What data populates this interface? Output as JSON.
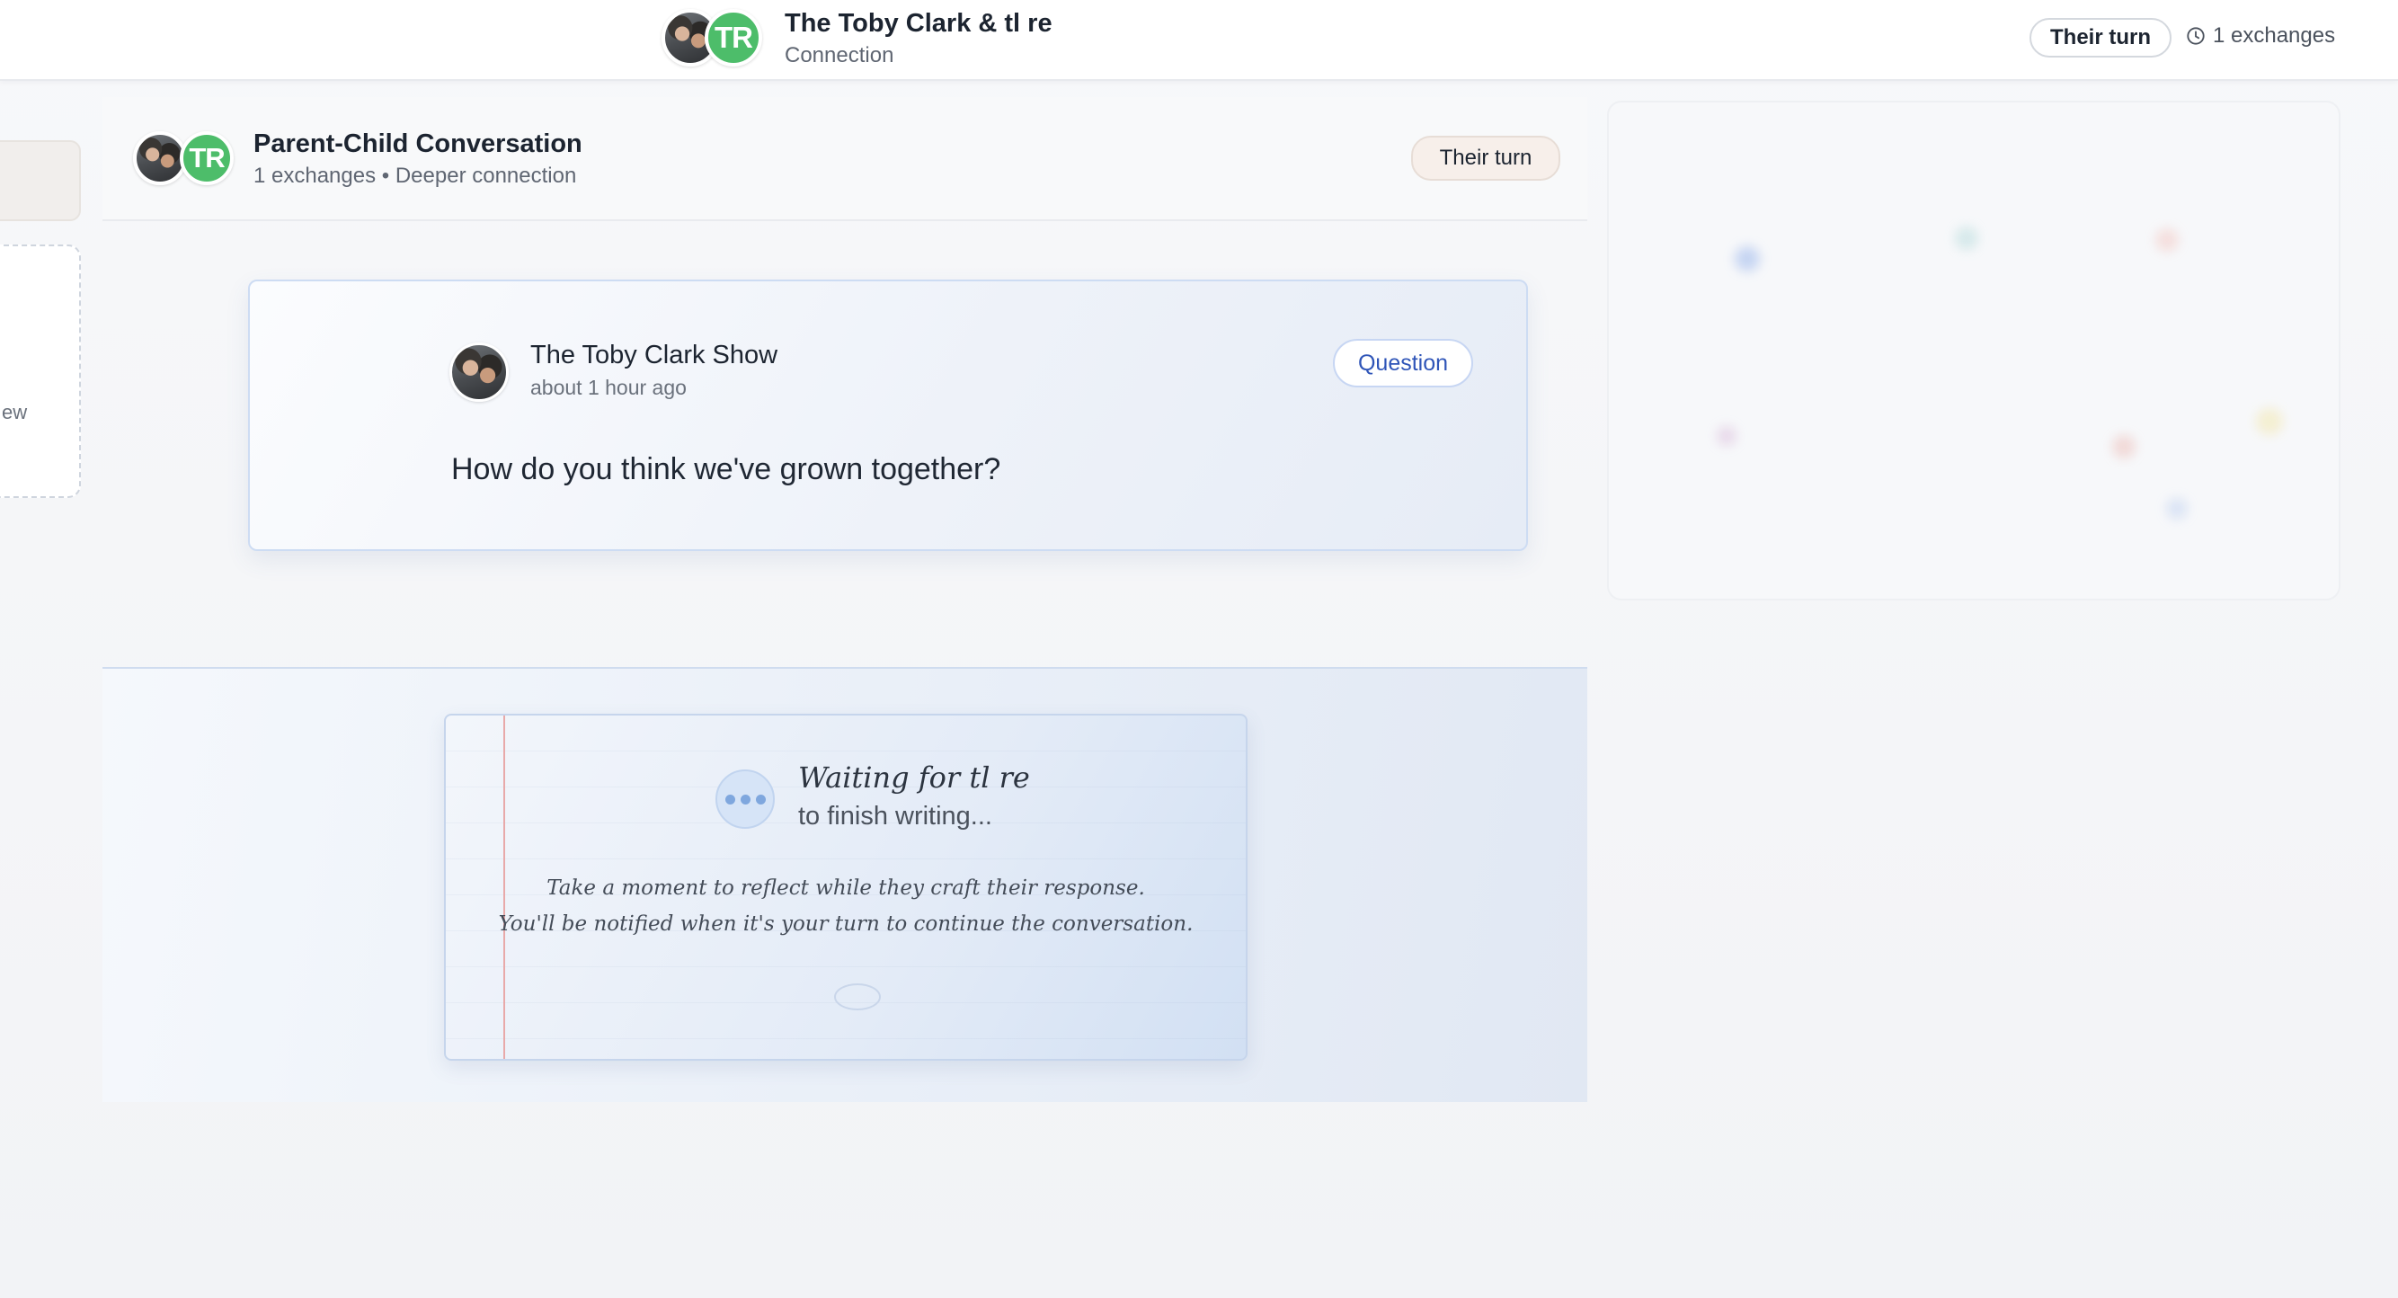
{
  "header": {
    "title": "The Toby Clark & tl re",
    "subtitle": "Connection",
    "avatar_initials": "TR",
    "turn_status": "Their turn",
    "exchanges": "1 exchanges",
    "clock_icon": "clock-icon"
  },
  "sidebar": {
    "partial_text": "ew"
  },
  "conversation": {
    "title": "Parent-Child Conversation",
    "meta": "1 exchanges • Deeper connection",
    "avatar_initials": "TR",
    "turn_status": "Their turn"
  },
  "message": {
    "author": "The Toby Clark Show",
    "time": "about 1 hour ago",
    "tag": "Question",
    "text": "How do you think we've grown together?"
  },
  "waiting": {
    "title": "Waiting for tl re",
    "subtitle": "to finish writing...",
    "note_line1": "Take a moment to reflect while they craft their response.",
    "note_line2": "You'll be notified when it's your turn to continue the conversation."
  },
  "colors": {
    "accent": "#2f55b8",
    "avatar_green": "#4dbd6a",
    "margin_red": "#e8a9a9"
  }
}
